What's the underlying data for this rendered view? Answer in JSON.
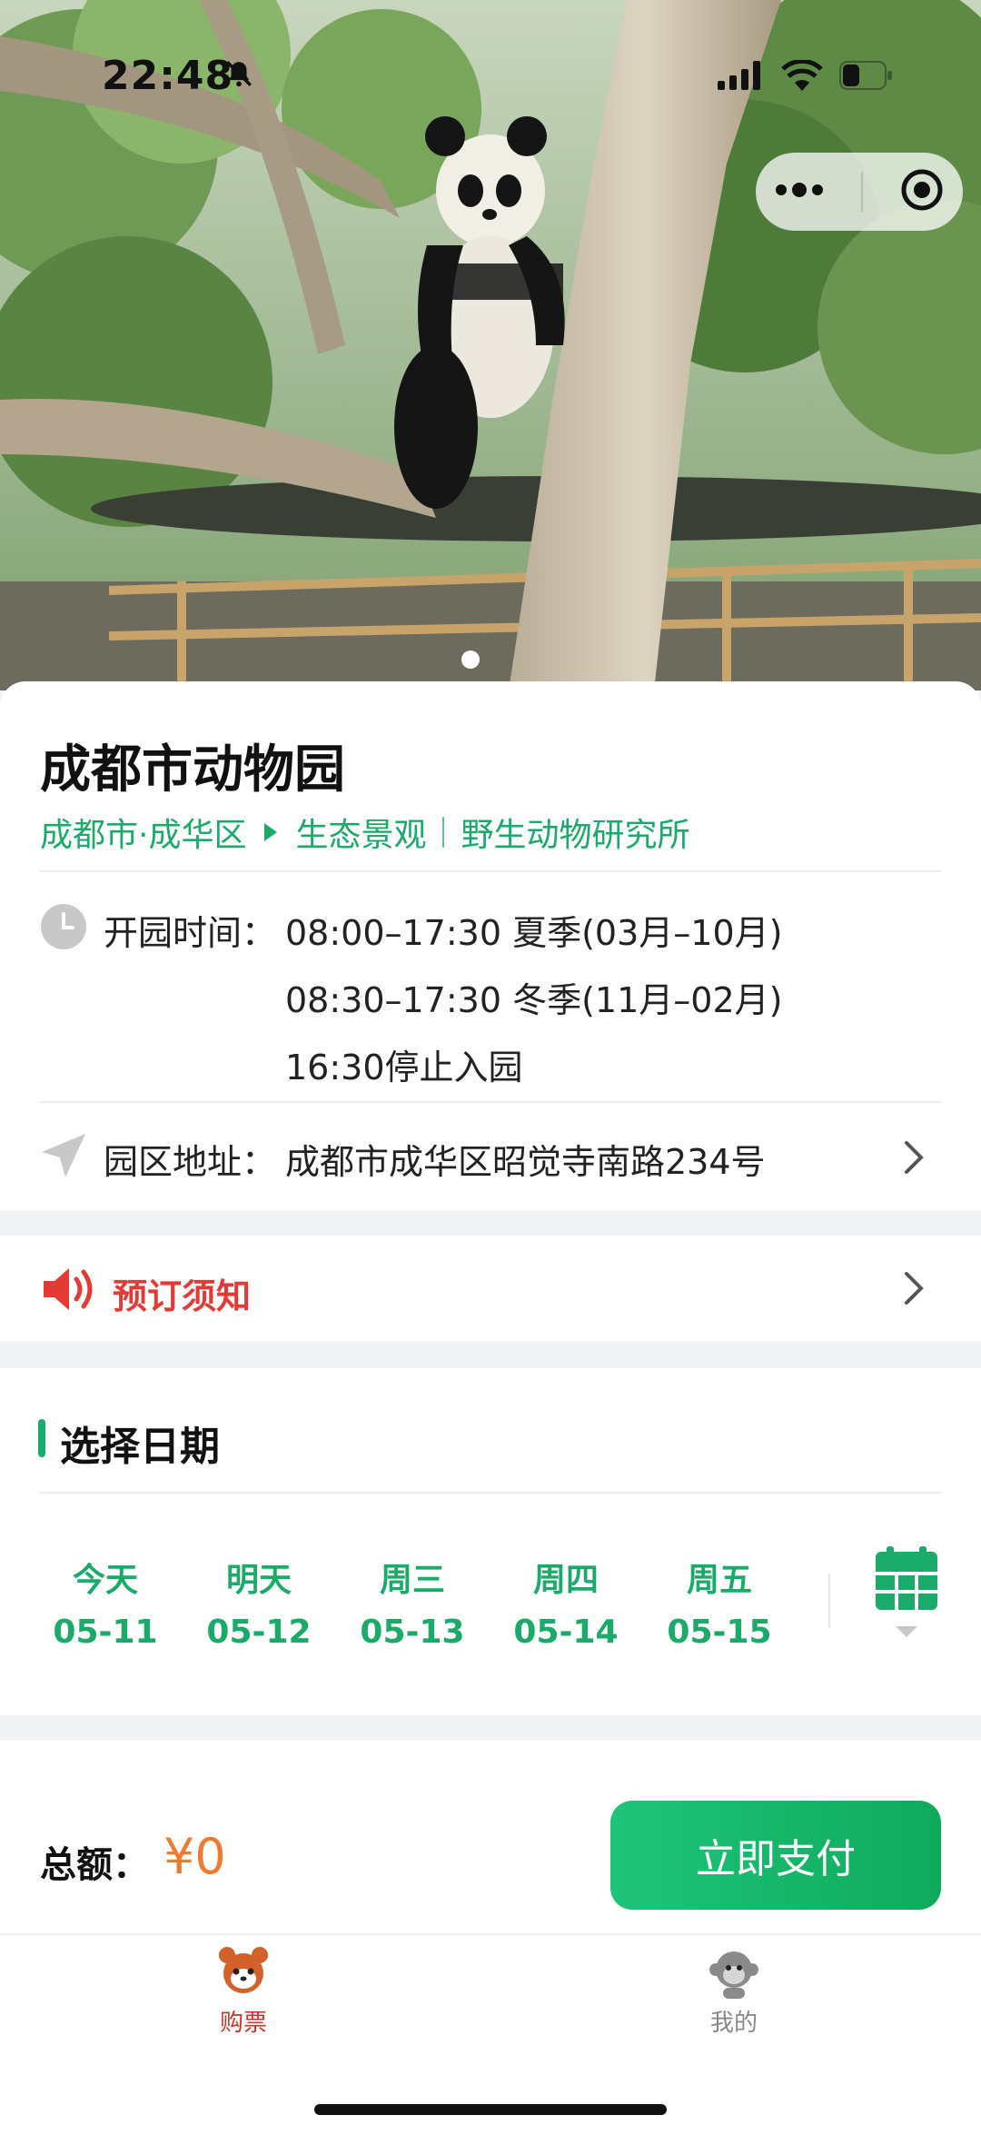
{
  "status_bar": {
    "time": "22:48"
  },
  "venue": {
    "name": "成都市动物园",
    "location": "成都市·成华区",
    "tags": [
      "生态景观",
      "野生动物研究所"
    ]
  },
  "hours": {
    "label": "开园时间：",
    "lines": [
      "08:00–17:30 夏季(03月–10月)",
      "08:30–17:30 冬季(11月–02月)",
      "16:30停止入园"
    ]
  },
  "address": {
    "label": "园区地址：",
    "value": "成都市成华区昭觉寺南路234号"
  },
  "notice": {
    "label": "预订须知"
  },
  "date_section": {
    "title": "选择日期",
    "dates": [
      {
        "day": "今天",
        "date": "05-11"
      },
      {
        "day": "明天",
        "date": "05-12"
      },
      {
        "day": "周三",
        "date": "05-13"
      },
      {
        "day": "周四",
        "date": "05-14"
      },
      {
        "day": "周五",
        "date": "05-15"
      }
    ]
  },
  "payment": {
    "total_label": "总额：",
    "total_value": "¥0",
    "pay_button": "立即支付"
  },
  "tabs": [
    {
      "label": "购票",
      "icon": "red-panda-icon",
      "active": true
    },
    {
      "label": "我的",
      "icon": "monkey-icon",
      "active": false
    }
  ],
  "colors": {
    "accent": "#1aaa6a",
    "alert": "#e53935",
    "price": "#f07a30",
    "active_tab": "#c0392b",
    "inactive_tab": "#888888"
  }
}
